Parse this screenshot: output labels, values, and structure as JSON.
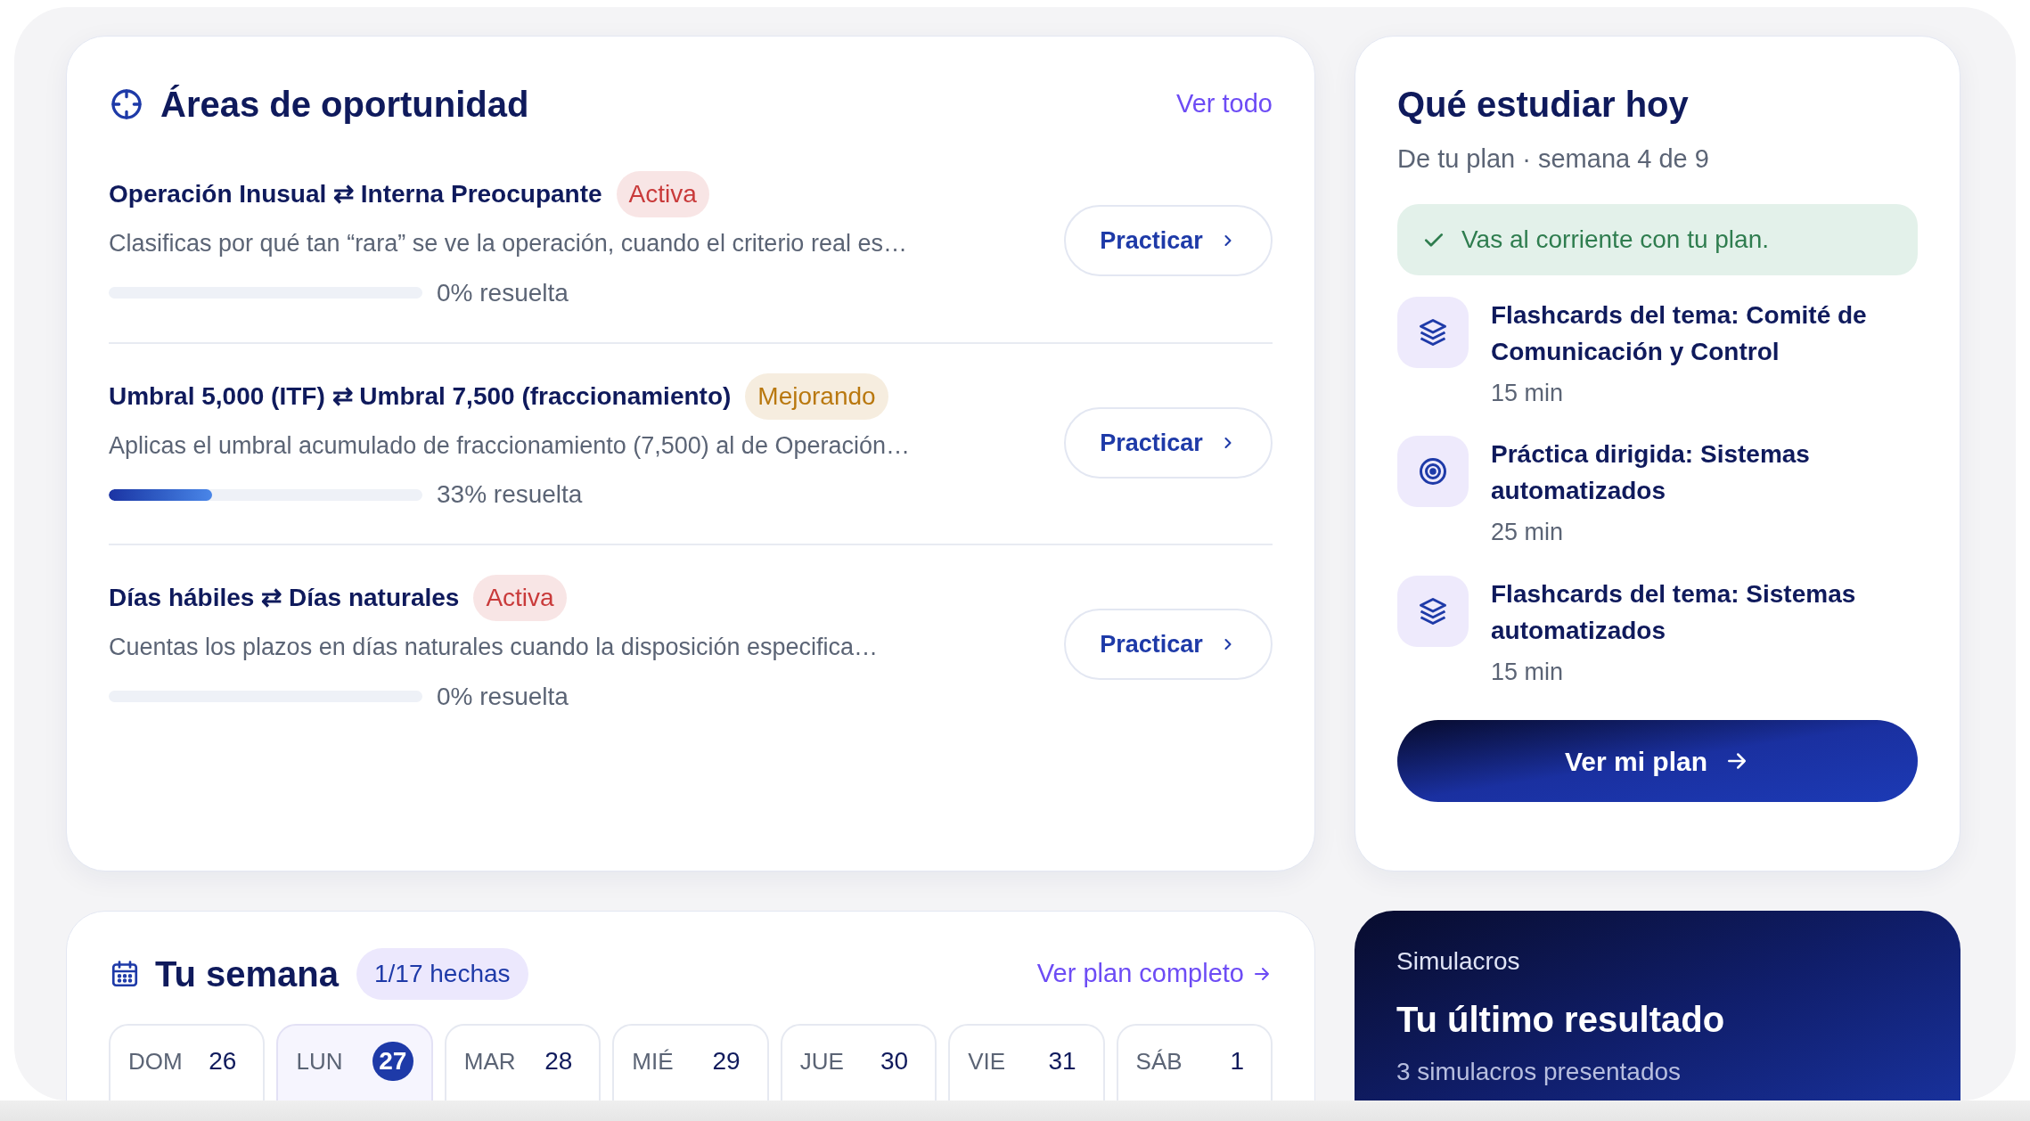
{
  "opportunities": {
    "title": "Áreas de oportunidad",
    "link": "Ver todo",
    "items": [
      {
        "left": "Operación Inusual",
        "arrow": "⇄",
        "right": "Interna Preocupante",
        "badge": {
          "label": "Activa",
          "color": "#c93a3a"
        },
        "description": "Clasificas por qué tan “rara” se ve la operación, cuando el criterio real es…",
        "level": 0,
        "progress_label": "0% resuelta",
        "button": "Practicar"
      },
      {
        "left": "Umbral 5,000 (ITF)",
        "arrow": "⇄",
        "right": "Umbral 7,500 (fraccionamiento)",
        "badge": {
          "label": "Mejorando",
          "color": "#b9780f"
        },
        "description": "Aplicas el umbral acumulado de fraccionamiento (7,500) al de Operación…",
        "level": 0.33,
        "progress_label": "33% resuelta",
        "button": "Practicar"
      },
      {
        "left": "Días hábiles",
        "arrow": "⇄",
        "right": "Días naturales",
        "badge": {
          "label": "Activa",
          "color": "#c93a3a"
        },
        "description": "Cuentas los plazos en días naturales cuando la disposición especifica…",
        "level": 0,
        "progress_label": "0% resuelta",
        "button": "Practicar"
      }
    ]
  },
  "today": {
    "title": "Qué estudiar hoy",
    "subtitle": "De tu plan · semana 4 de 9",
    "status": "Vas al corriente con tu plan.",
    "items": [
      {
        "kind": "flashcards",
        "title": "Flashcards del tema: Comité de Comunicación y Control",
        "duration": "15 min"
      },
      {
        "kind": "practice",
        "title": "Práctica dirigida: Sistemas automatizados",
        "duration": "25 min"
      },
      {
        "kind": "flashcards",
        "title": "Flashcards del tema: Sistemas automatizados",
        "duration": "15 min"
      }
    ],
    "button": "Ver mi plan"
  },
  "week": {
    "title": "Tu semana",
    "badge": "1/17 hechas",
    "link": "Ver plan completo",
    "days": [
      {
        "day": "DOM",
        "date": "26",
        "selected": false
      },
      {
        "day": "LUN",
        "date": "27",
        "selected": true
      },
      {
        "day": "MAR",
        "date": "28",
        "selected": false
      },
      {
        "day": "MIÉ",
        "date": "29",
        "selected": false
      },
      {
        "day": "JUE",
        "date": "30",
        "selected": false
      },
      {
        "day": "VIE",
        "date": "31",
        "selected": false
      },
      {
        "day": "SÁB",
        "date": "1",
        "selected": false
      }
    ]
  },
  "simulacros": {
    "label": "Simulacros",
    "title": "Tu último resultado",
    "subtitle": "3 simulacros presentados"
  }
}
